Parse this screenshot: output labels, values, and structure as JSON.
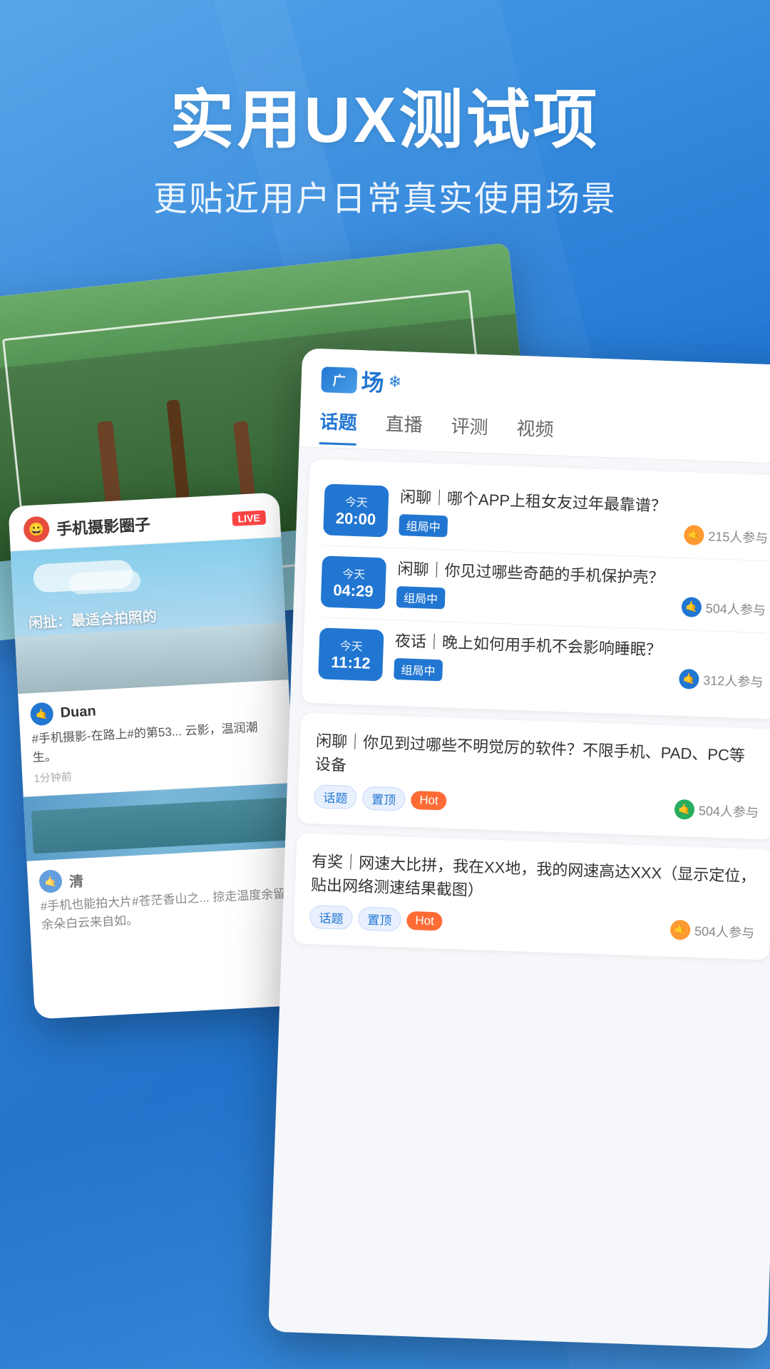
{
  "header": {
    "main_title": "实用UX测试项",
    "sub_title": "更贴近用户日常真实使用场景"
  },
  "phone_card": {
    "channel_name": "手机摄影圈子",
    "live_badge": "LIVE",
    "feed_text": "闲扯：最适合拍照的",
    "feed_items": [
      {
        "username": "Duan",
        "content": "#手机摄影-在路上#的第53... 云影，温润潮生。",
        "time": "1分钟前"
      },
      {
        "username": "清",
        "content": "#手机也能拍大片#苍茫香山之... 掠走温度余留余朵白云来自如。",
        "time": ""
      }
    ]
  },
  "app_card": {
    "brand": "广场",
    "nav_tabs": [
      "话题",
      "直播",
      "评测",
      "视频"
    ],
    "active_tab": "话题",
    "discussions_grouped": [
      {
        "time_today": "今天",
        "time": "20:00",
        "title": "闲聊｜哪个APP上租女友过年最靠谱？",
        "badge": "组局中",
        "participants": "215人参与",
        "icon_color": "orange"
      },
      {
        "time_today": "今天",
        "time": "04:29",
        "title": "闲聊｜你见过哪些奇葩的手机保护壳？",
        "badge": "组局中",
        "participants": "504人参与",
        "icon_color": "blue"
      },
      {
        "time_today": "今天",
        "time": "11:12",
        "title": "夜话｜晚上如何用手机不会影响睡眠？",
        "badge": "组局中",
        "participants": "312人参与",
        "icon_color": "blue"
      }
    ],
    "discussion_single_1": {
      "title": "闲聊｜你见到过哪些不明觉厉的软件？不限手机、PAD、PC等设备",
      "badges": [
        "话题",
        "置顶",
        "Hot"
      ],
      "participants": "504人参与",
      "icon_color": "green"
    },
    "discussion_single_2": {
      "title": "有奖｜网速大比拼，我在XX地，我的网速高达XXX（显示定位，贴出网络测速结果截图）",
      "badges": [
        "话题",
        "置顶",
        "Hot"
      ],
      "participants": "504人参与",
      "icon_color": "orange"
    }
  },
  "colors": {
    "primary": "#2176d2",
    "accent": "#4a9fe8",
    "background_start": "#4a9fe8",
    "background_end": "#1a6ec9",
    "hot_badge": "#ff6b35",
    "red_avatar": "#e74c3c",
    "green": "#27ae60",
    "orange": "#ff9933"
  }
}
